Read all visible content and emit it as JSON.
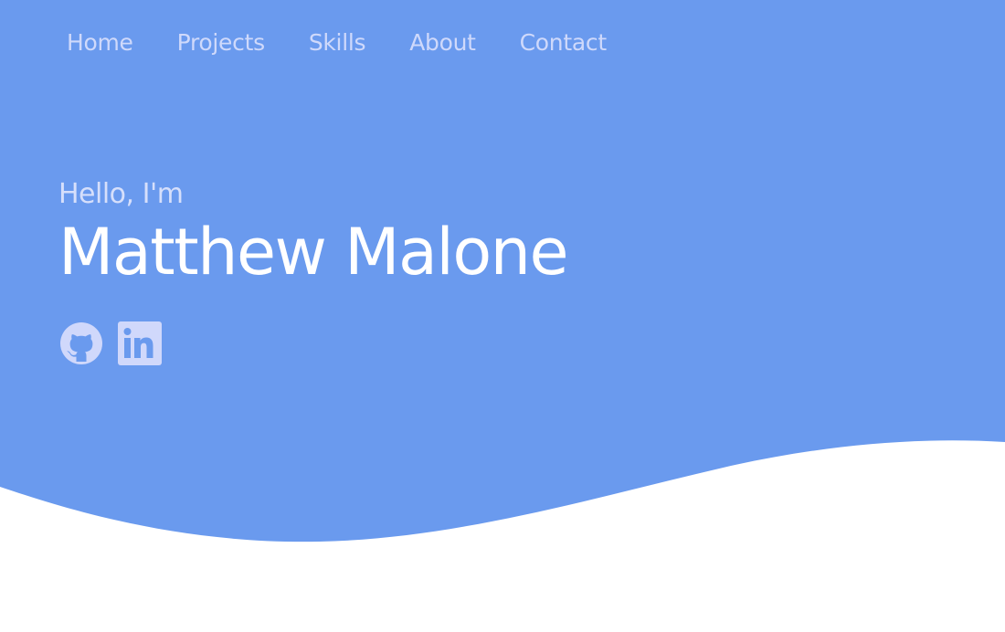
{
  "colors": {
    "hero_background": "#6a9aee",
    "page_background": "#ffffff",
    "nav_text": "#cfd9fb",
    "greeting_text": "#d6dffb",
    "name_text": "#ffffff",
    "icon_color": "#d0d8fb"
  },
  "nav": {
    "items": [
      {
        "label": "Home"
      },
      {
        "label": "Projects"
      },
      {
        "label": "Skills"
      },
      {
        "label": "About"
      },
      {
        "label": "Contact"
      }
    ]
  },
  "hero": {
    "greeting": "Hello, I'm",
    "name": "Matthew Malone"
  },
  "socials": [
    {
      "icon": "github-icon"
    },
    {
      "icon": "linkedin-icon"
    }
  ]
}
